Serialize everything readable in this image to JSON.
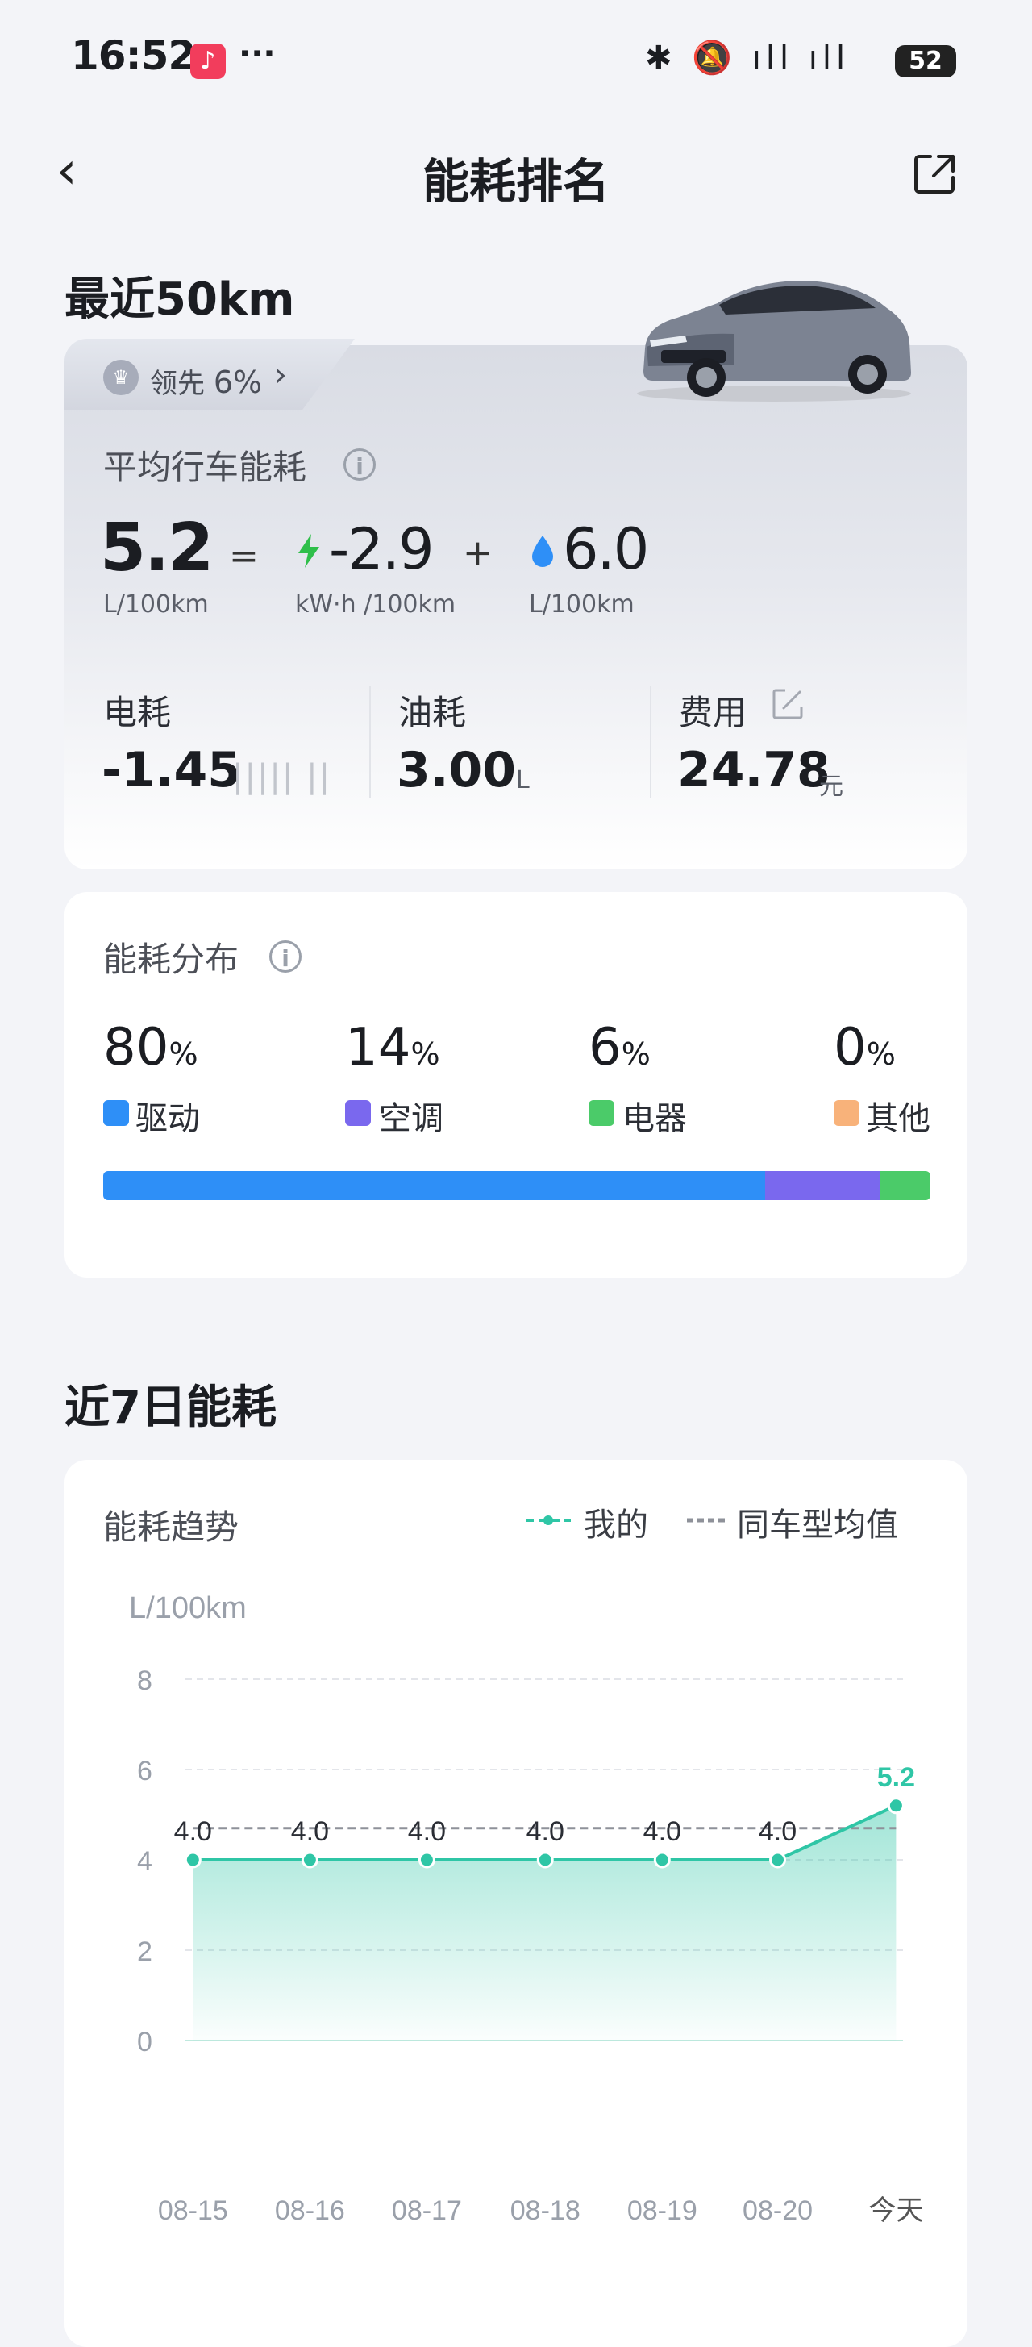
{
  "status_bar": {
    "time": "16:52",
    "dots": "···",
    "icons": "✱ 🔕 ıll ıll",
    "battery": "52"
  },
  "nav": {
    "title": "能耗排名"
  },
  "section1": {
    "title": "最近50km",
    "lead_prefix": "领先",
    "lead_value": "6%",
    "avg_label": "平均行车能耗",
    "total_value": "5.2",
    "total_unit": "L/100km",
    "equals": "=",
    "elec_value": "-2.9",
    "elec_unit": "kW·h /100km",
    "plus": "+",
    "fuel_value": "6.0",
    "fuel_unit": "L/100km",
    "elec_usage_label": "电耗",
    "elec_usage_value": "-1.45",
    "fuel_usage_label": "油耗",
    "fuel_usage_value": "3.00",
    "fuel_usage_unit": "L",
    "cost_label": "费用",
    "cost_value": "24.78",
    "cost_unit": "元"
  },
  "distribution": {
    "title": "能耗分布",
    "items": [
      {
        "value": "80",
        "unit": "%",
        "label": "驱动",
        "color": "#2e8ff7",
        "fraction": 0.8
      },
      {
        "value": "14",
        "unit": "%",
        "label": "空调",
        "color": "#7a68ee",
        "fraction": 0.14
      },
      {
        "value": "6",
        "unit": "%",
        "label": "电器",
        "color": "#4bcb69",
        "fraction": 0.06
      },
      {
        "value": "0",
        "unit": "%",
        "label": "其他",
        "color": "#f8b27a",
        "fraction": 0.0
      }
    ]
  },
  "section2": {
    "title": "近7日能耗"
  },
  "trend": {
    "title": "能耗趋势",
    "legend_mine": "我的",
    "legend_avg": "同车型均值"
  },
  "chart_data": {
    "type": "area",
    "ylabel": "L/100km",
    "ylim": [
      0,
      8
    ],
    "yticks": [
      0,
      2,
      4,
      6,
      8
    ],
    "categories": [
      "08-15",
      "08-16",
      "08-17",
      "08-18",
      "08-19",
      "08-20",
      "今天"
    ],
    "series": [
      {
        "name": "我的",
        "values": [
          4.0,
          4.0,
          4.0,
          4.0,
          4.0,
          4.0,
          5.2
        ],
        "color": "#2fc6a6"
      },
      {
        "name": "同车型均值",
        "values": [
          4.7,
          4.7,
          4.7,
          4.7,
          4.7,
          4.7,
          4.7
        ],
        "color": "#8e9199",
        "style": "dashed"
      }
    ],
    "data_labels": [
      "4.0",
      "4.0",
      "4.0",
      "4.0",
      "4.0",
      "4.0",
      "5.2"
    ],
    "grid": true
  }
}
